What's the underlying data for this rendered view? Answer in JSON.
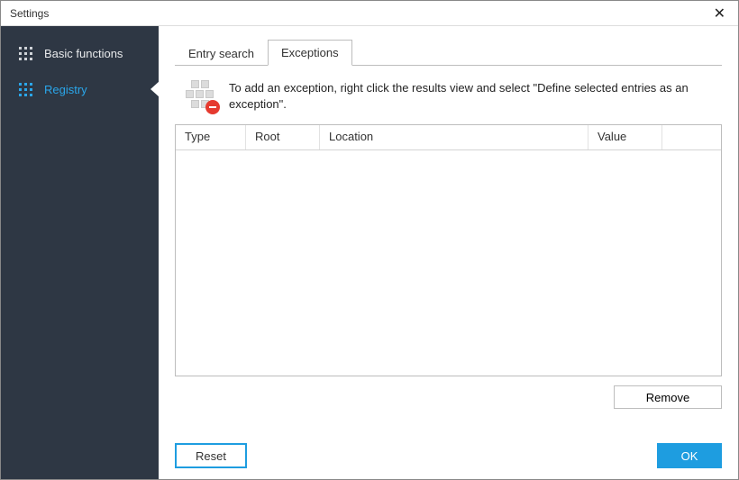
{
  "window": {
    "title": "Settings"
  },
  "sidebar": {
    "items": [
      {
        "label": "Basic functions",
        "active": false
      },
      {
        "label": "Registry",
        "active": true
      }
    ]
  },
  "tabs": [
    {
      "label": "Entry search",
      "active": false
    },
    {
      "label": "Exceptions",
      "active": true
    }
  ],
  "info": {
    "text": "To add an exception, right click the results view and select \"Define selected entries as an exception\"."
  },
  "table": {
    "columns": {
      "type": "Type",
      "root": "Root",
      "location": "Location",
      "value": "Value"
    }
  },
  "buttons": {
    "remove": "Remove",
    "reset": "Reset",
    "ok": "OK"
  }
}
